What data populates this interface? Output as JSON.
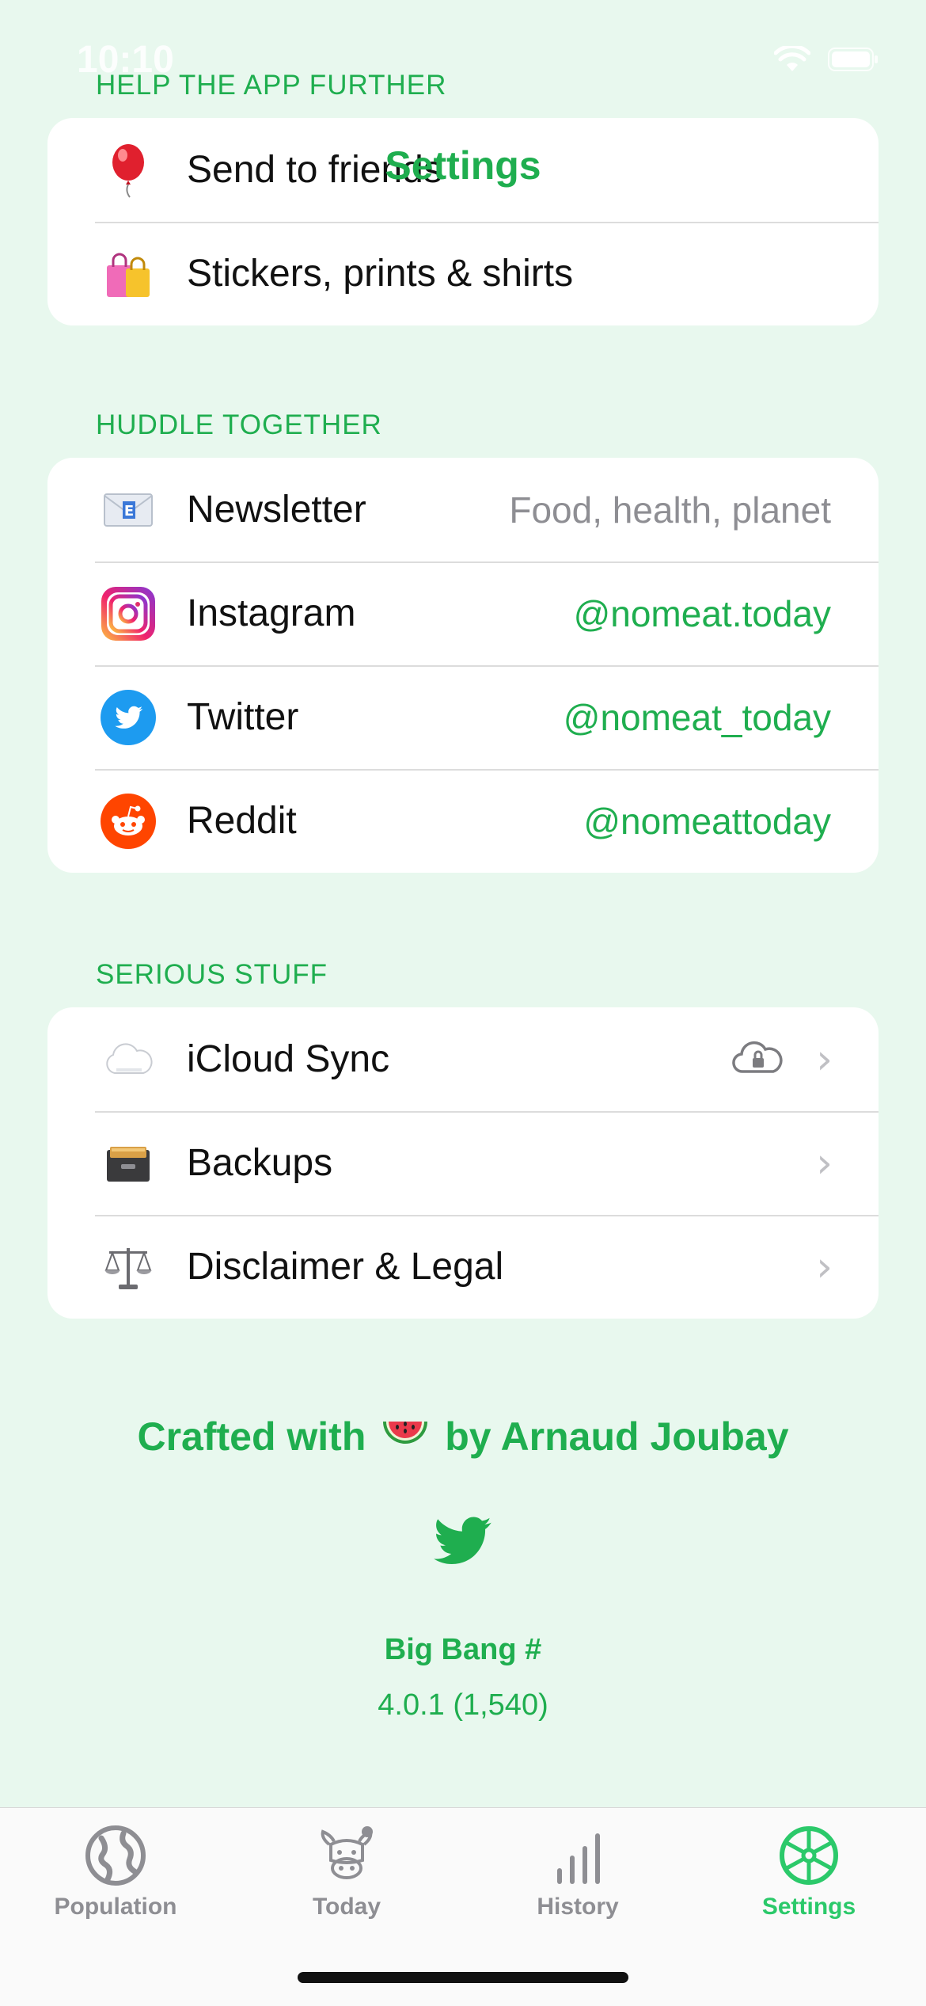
{
  "status_bar": {
    "time": "10:10"
  },
  "nav": {
    "title": "Settings"
  },
  "sections": {
    "help": {
      "header": "HELP THE APP FURTHER",
      "rows": [
        {
          "label": "Send to friends",
          "icon": "balloon-icon"
        },
        {
          "label": "Stickers, prints & shirts",
          "icon": "shopping-bags-icon"
        }
      ]
    },
    "huddle": {
      "header": "HUDDLE TOGETHER",
      "rows": [
        {
          "label": "Newsletter",
          "detail": "Food, health, planet",
          "icon": "envelope-icon"
        },
        {
          "label": "Instagram",
          "detail": "@nomeat.today",
          "icon": "instagram-icon"
        },
        {
          "label": "Twitter",
          "detail": "@nomeat_today",
          "icon": "twitter-icon"
        },
        {
          "label": "Reddit",
          "detail": "@nomeattoday",
          "icon": "reddit-icon"
        }
      ]
    },
    "serious": {
      "header": "SERIOUS STUFF",
      "rows": [
        {
          "label": "iCloud Sync",
          "icon": "cloud-icon"
        },
        {
          "label": "Backups",
          "icon": "file-cabinet-icon"
        },
        {
          "label": "Disclaimer & Legal",
          "icon": "scales-icon"
        }
      ]
    }
  },
  "footer": {
    "credit_prefix": "Crafted with",
    "credit_suffix": "by Arnaud Joubay",
    "bigbang": "Big Bang #",
    "version": "4.0.1 (1,540)"
  },
  "tabs": [
    {
      "label": "Population",
      "icon": "globe-icon"
    },
    {
      "label": "Today",
      "icon": "cow-icon"
    },
    {
      "label": "History",
      "icon": "bar-chart-icon"
    },
    {
      "label": "Settings",
      "icon": "wheel-icon",
      "active": true
    }
  ],
  "colors": {
    "accent": "#1fae4f",
    "background": "#e8f8ee",
    "tab_active": "#2bc96a"
  }
}
